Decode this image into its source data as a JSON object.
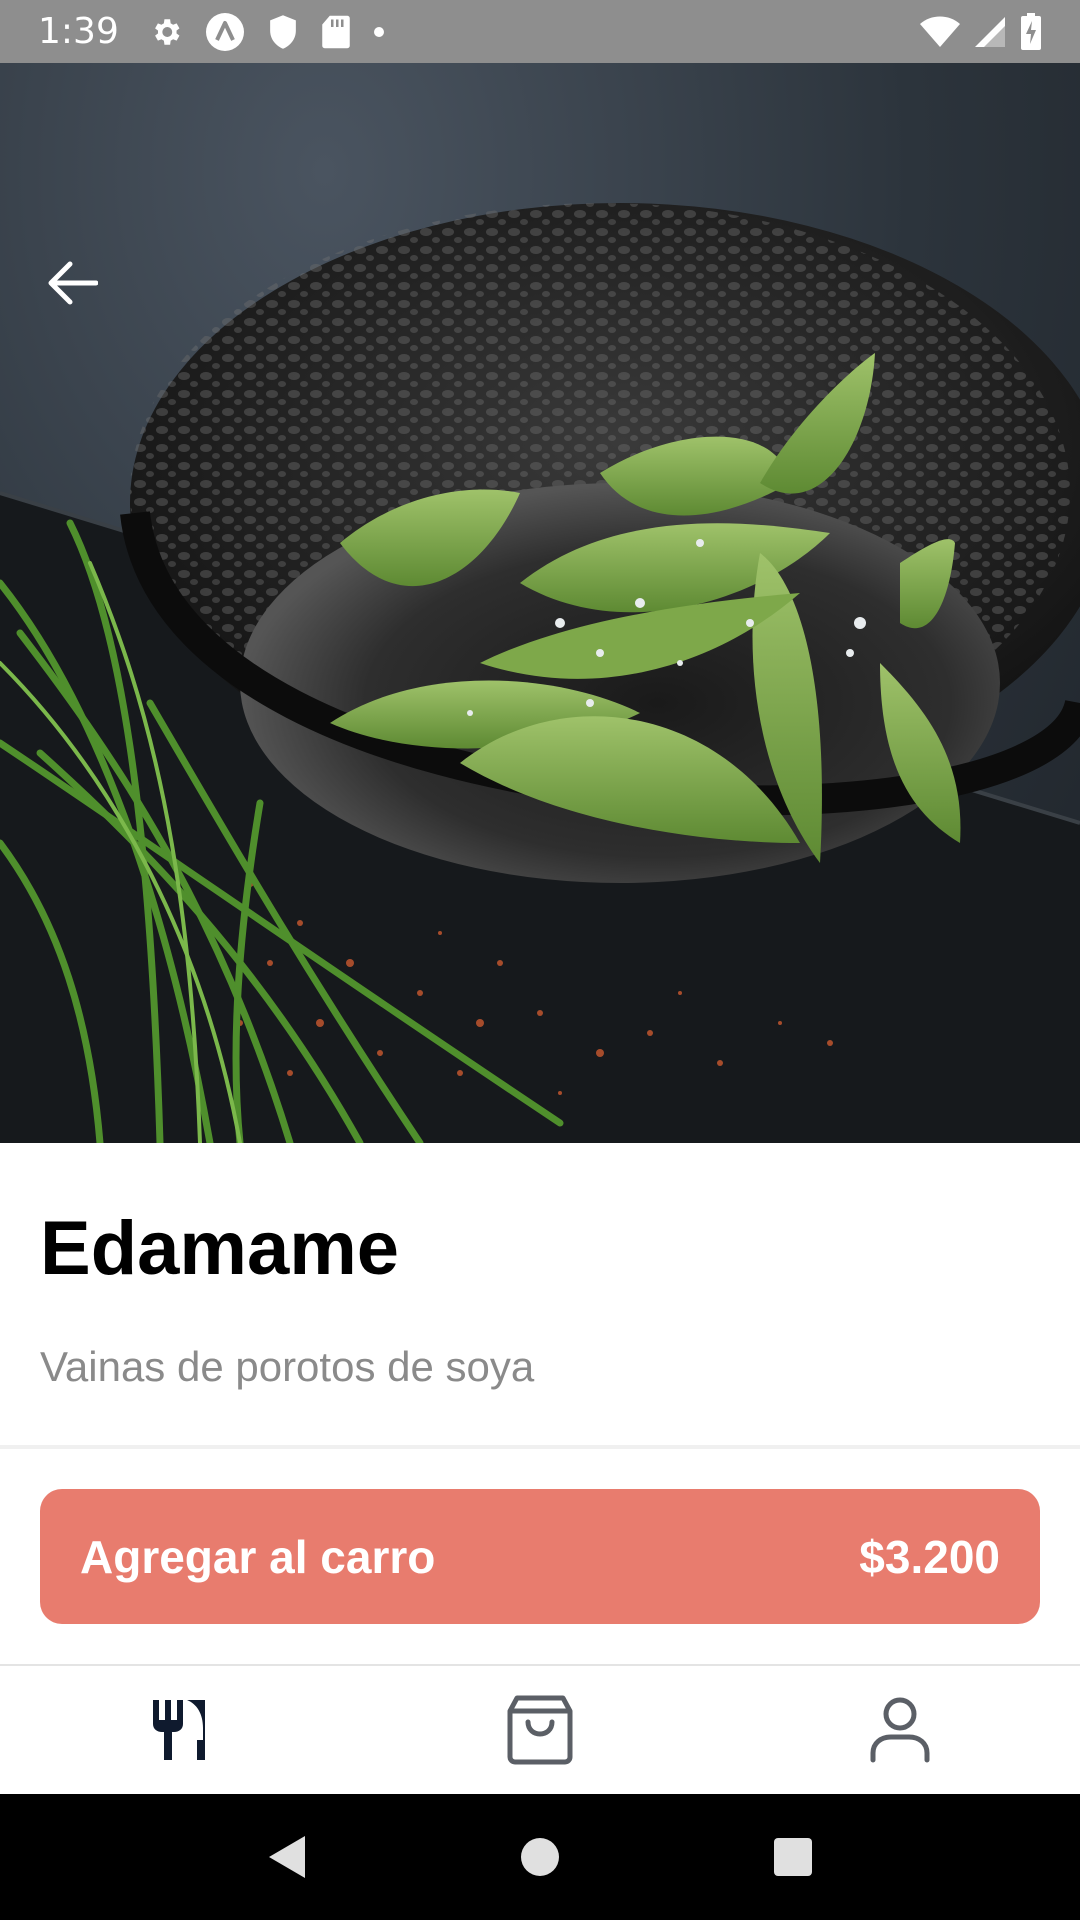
{
  "status_bar": {
    "time": "1:39",
    "icons_left": [
      "settings-icon",
      "app-logo-icon",
      "shield-icon",
      "sd-card-icon",
      "notification-dot-icon"
    ],
    "icons_right": [
      "wifi-icon",
      "cell-signal-icon",
      "battery-icon"
    ]
  },
  "hero": {
    "image_alt_icon": "back-arrow-icon"
  },
  "product": {
    "title": "Edamame",
    "description": "Vainas de porotos de soya"
  },
  "cart_button": {
    "label": "Agregar al carro",
    "price": "$3.200",
    "color": "#e87c6e"
  },
  "bottom_nav": {
    "items": [
      {
        "icon": "fork-knife-icon",
        "active": true
      },
      {
        "icon": "shopping-bag-icon",
        "active": false
      },
      {
        "icon": "user-icon",
        "active": false
      }
    ],
    "active_color": "#0f1a2e",
    "inactive_color": "#5b5f66"
  },
  "system_nav": {
    "items": [
      "back-triangle-icon",
      "home-circle-icon",
      "recents-square-icon"
    ]
  }
}
